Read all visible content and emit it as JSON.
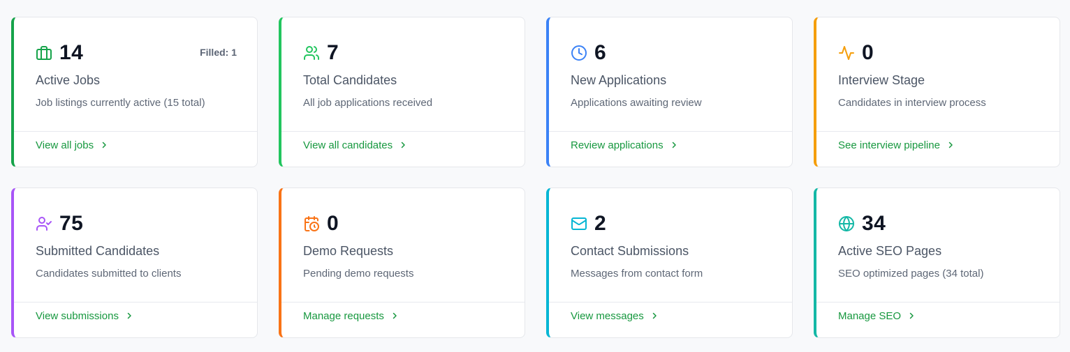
{
  "cards": [
    {
      "icon": "briefcase-icon",
      "accent": "#16a34a",
      "value": "14",
      "badge": "Filled: 1",
      "title": "Active Jobs",
      "description": "Job listings currently active (15 total)",
      "link": "View all jobs"
    },
    {
      "icon": "users-icon",
      "accent": "#22c55e",
      "value": "7",
      "title": "Total Candidates",
      "description": "All job applications received",
      "link": "View all candidates"
    },
    {
      "icon": "clock-icon",
      "accent": "#3b82f6",
      "value": "6",
      "title": "New Applications",
      "description": "Applications awaiting review",
      "link": "Review applications"
    },
    {
      "icon": "activity-icon",
      "accent": "#f59e0b",
      "value": "0",
      "title": "Interview Stage",
      "description": "Candidates in interview process",
      "link": "See interview pipeline"
    },
    {
      "icon": "user-check-icon",
      "accent": "#a855f7",
      "value": "75",
      "title": "Submitted Candidates",
      "description": "Candidates submitted to clients",
      "link": "View submissions"
    },
    {
      "icon": "calendar-clock-icon",
      "accent": "#f97316",
      "value": "0",
      "title": "Demo Requests",
      "description": "Pending demo requests",
      "link": "Manage requests"
    },
    {
      "icon": "mail-icon",
      "accent": "#06b6d4",
      "value": "2",
      "title": "Contact Submissions",
      "description": "Messages from contact form",
      "link": "View messages"
    },
    {
      "icon": "globe-icon",
      "accent": "#14b8a6",
      "value": "34",
      "title": "Active SEO Pages",
      "description": "SEO optimized pages (34 total)",
      "link": "Manage SEO"
    }
  ]
}
